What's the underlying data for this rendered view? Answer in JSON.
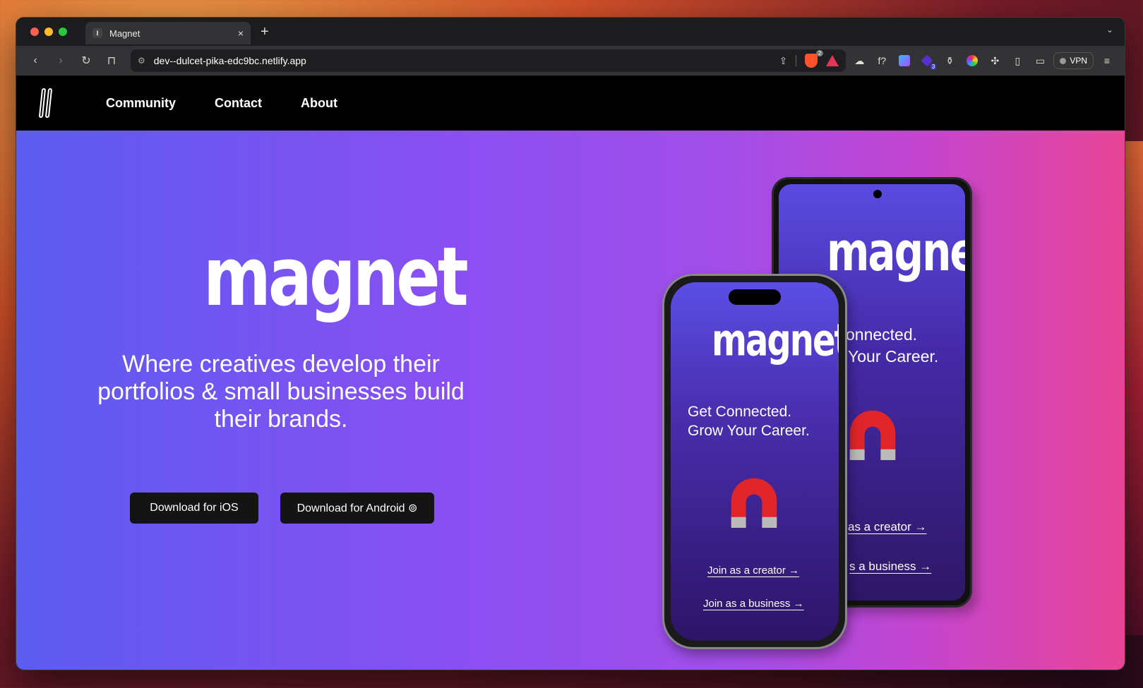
{
  "browser": {
    "tab_title": "Magnet",
    "new_tab_symbol": "+",
    "close_symbol": "×",
    "url": "dev--dulcet-pika-edc9bc.netlify.app",
    "shield_count": "2",
    "ext_badge": "3",
    "vpn_label": "VPN",
    "fx_label": "f?"
  },
  "site": {
    "nav": [
      "Community",
      "Contact",
      "About"
    ],
    "wordmark": "magnet",
    "tagline": "Where creatives develop their portfolios & small businesses build their brands.",
    "btn_ios": "Download for iOS ",
    "btn_android": "Download for Android ⊚"
  },
  "phone": {
    "headline_1": "Get Connected.",
    "headline_2": "Grow Your Career.",
    "android_headline_1": "onnected.",
    "android_headline_2": "Your Career.",
    "link_creator": "Join as a creator →",
    "link_business": "Join as a business →",
    "android_link_creator": "as a creator →",
    "android_link_business": "s a business →"
  },
  "colors": {
    "hero_start": "#5c5cf0",
    "hero_end": "#e84596",
    "magnet_red": "#e0262b"
  }
}
